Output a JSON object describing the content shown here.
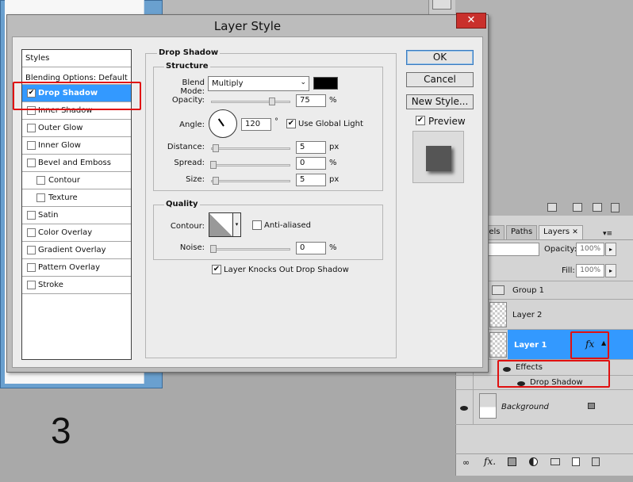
{
  "dialog": {
    "title": "Layer Style",
    "close_label": "✕",
    "styles_header": "Styles",
    "blending_options": "Blending Options: Default",
    "styles": [
      {
        "label": "Drop Shadow",
        "checked": true,
        "selected": true
      },
      {
        "label": "Inner Shadow",
        "checked": false
      },
      {
        "label": "Outer Glow",
        "checked": false
      },
      {
        "label": "Inner Glow",
        "checked": false
      },
      {
        "label": "Bevel and Emboss",
        "checked": false
      },
      {
        "label": "Contour",
        "checked": false,
        "indent": true
      },
      {
        "label": "Texture",
        "checked": false,
        "indent": true
      },
      {
        "label": "Satin",
        "checked": false
      },
      {
        "label": "Color Overlay",
        "checked": false
      },
      {
        "label": "Gradient Overlay",
        "checked": false
      },
      {
        "label": "Pattern Overlay",
        "checked": false
      },
      {
        "label": "Stroke",
        "checked": false
      }
    ],
    "section_title": "Drop Shadow",
    "structure_title": "Structure",
    "blend_mode_label": "Blend Mode:",
    "blend_mode_value": "Multiply",
    "shadow_color": "#000000",
    "opacity_label": "Opacity:",
    "opacity_value": "75",
    "percent": "%",
    "angle_label": "Angle:",
    "angle_value": "120",
    "degree": "°",
    "use_global_light": "Use Global Light",
    "use_global_light_checked": true,
    "distance_label": "Distance:",
    "distance_value": "5",
    "spread_label": "Spread:",
    "spread_value": "0",
    "size_label": "Size:",
    "size_value": "5",
    "px": "px",
    "quality_title": "Quality",
    "contour_label": "Contour:",
    "anti_aliased": "Anti-aliased",
    "anti_aliased_checked": false,
    "noise_label": "Noise:",
    "noise_value": "0",
    "knockout_label": "Layer Knocks Out Drop Shadow",
    "knockout_checked": true,
    "ok_label": "OK",
    "cancel_label": "Cancel",
    "new_style_label": "New Style...",
    "preview_label": "Preview",
    "preview_checked": true
  },
  "layers_panel": {
    "tabs": [
      "nels",
      "Paths",
      "Layers"
    ],
    "tab_close": "✕",
    "opacity_label": "Opacity:",
    "opacity_value": "100%",
    "fill_label": "Fill:",
    "fill_value": "100%",
    "layers": [
      {
        "name": "Group 1"
      },
      {
        "name": "Layer 2"
      },
      {
        "name": "Layer 1",
        "selected": true,
        "fx": "fx"
      },
      {
        "name": "Effects"
      },
      {
        "name": "Drop Shadow"
      },
      {
        "name": "Background"
      }
    ],
    "selected_color": "#3399ff"
  },
  "annotation": {
    "step_number": "3",
    "highlight_color": "#e01010"
  }
}
